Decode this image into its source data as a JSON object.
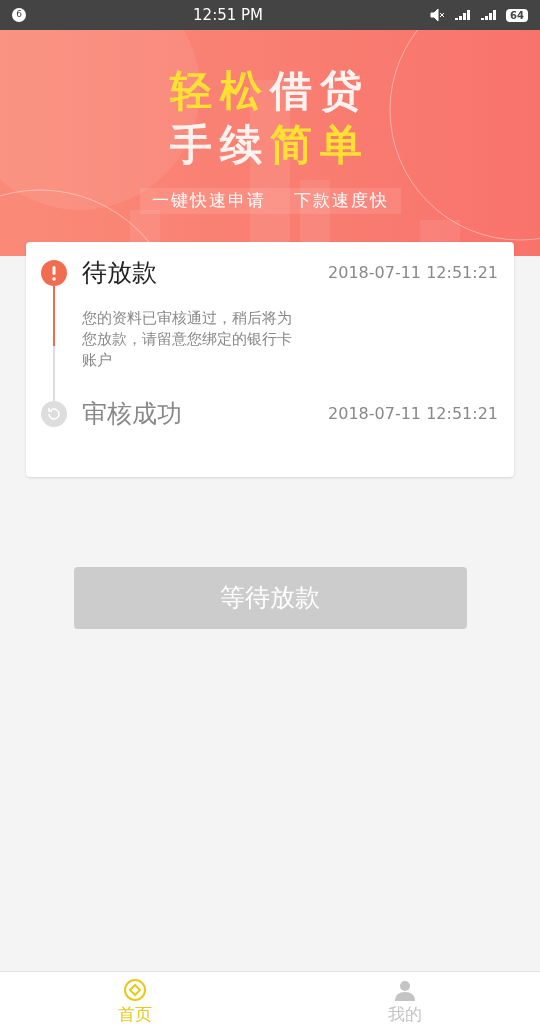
{
  "status_bar": {
    "notification_count": "6",
    "time": "12:51 PM",
    "battery": "64"
  },
  "banner": {
    "title_lines": [
      [
        {
          "text": "轻松",
          "highlight": true
        },
        {
          "text": "借贷",
          "highlight": false
        }
      ],
      [
        {
          "text": "手续",
          "highlight": false
        },
        {
          "text": "简单",
          "highlight": true
        }
      ]
    ],
    "slogans": [
      "一键快速申请",
      "下款速度快"
    ]
  },
  "steps": [
    {
      "kind": "current",
      "title": "待放款",
      "time": "2018-07-11 12:51:21",
      "description": "您的资料已审核通过，稍后将为您放款，请留意您绑定的银行卡账户"
    },
    {
      "kind": "done",
      "title": "审核成功",
      "time": "2018-07-11 12:51:21"
    }
  ],
  "action_button": {
    "label": "等待放款",
    "disabled": true
  },
  "tabs": [
    {
      "label": "首页",
      "kind": "coin",
      "selected": true
    },
    {
      "label": "我的",
      "kind": "person",
      "selected": false
    }
  ]
}
